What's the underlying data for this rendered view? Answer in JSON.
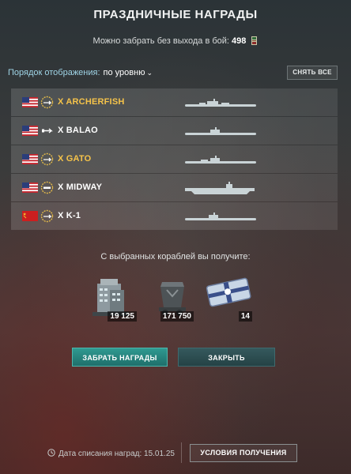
{
  "header": {
    "title": "ПРАЗДНИЧНЫЕ НАГРАДЫ",
    "subtitle_prefix": "Можно забрать без выхода в бой:",
    "subtitle_count": "498",
    "subtitle_icon": "token-icon"
  },
  "sort": {
    "label": "Порядок отображения:",
    "value": "по уровню",
    "chevron_icon": "chevron-down-icon"
  },
  "toolbar": {
    "reset_label": "СНЯТЬ ВСЕ"
  },
  "ships": [
    {
      "name": "X ARCHERFISH",
      "flag": "usa-flag-icon",
      "name_color": "#f5c34a",
      "silhouette": "submarine"
    },
    {
      "name": "X BALAO",
      "flag": "usa-flag-icon",
      "name_color": "#ffffff",
      "silhouette": "submarine"
    },
    {
      "name": "X GATO",
      "flag": "usa-flag-icon",
      "name_color": "#f5c34a",
      "silhouette": "submarine"
    },
    {
      "name": "X MIDWAY",
      "flag": "usa-flag-icon",
      "name_color": "#ffffff",
      "silhouette": "aircraft-carrier"
    },
    {
      "name": "X K-1",
      "flag": "ussr-flag-icon",
      "name_color": "#ffffff",
      "silhouette": "submarine"
    }
  ],
  "rewards": {
    "caption": "С выбранных кораблей вы получите:",
    "items": [
      {
        "icon": "dockyard-building-icon",
        "amount": "19 125"
      },
      {
        "icon": "coal-cart-icon",
        "amount": "171 750"
      },
      {
        "icon": "gift-container-icon",
        "amount": "14"
      }
    ]
  },
  "actions": {
    "claim_label": "ЗАБРАТЬ НАГРАДЫ",
    "close_label": "ЗАКРЫТЬ"
  },
  "footer": {
    "clock_icon": "clock-icon",
    "expiry_text": "Дата списания наград: 15.01.25",
    "conditions_label": "УСЛОВИЯ ПОЛУЧЕНИЯ"
  },
  "colors": {
    "gold": "#f5c34a",
    "accent_teal": "#2f9a91",
    "sort_label": "#9fd4e6"
  }
}
